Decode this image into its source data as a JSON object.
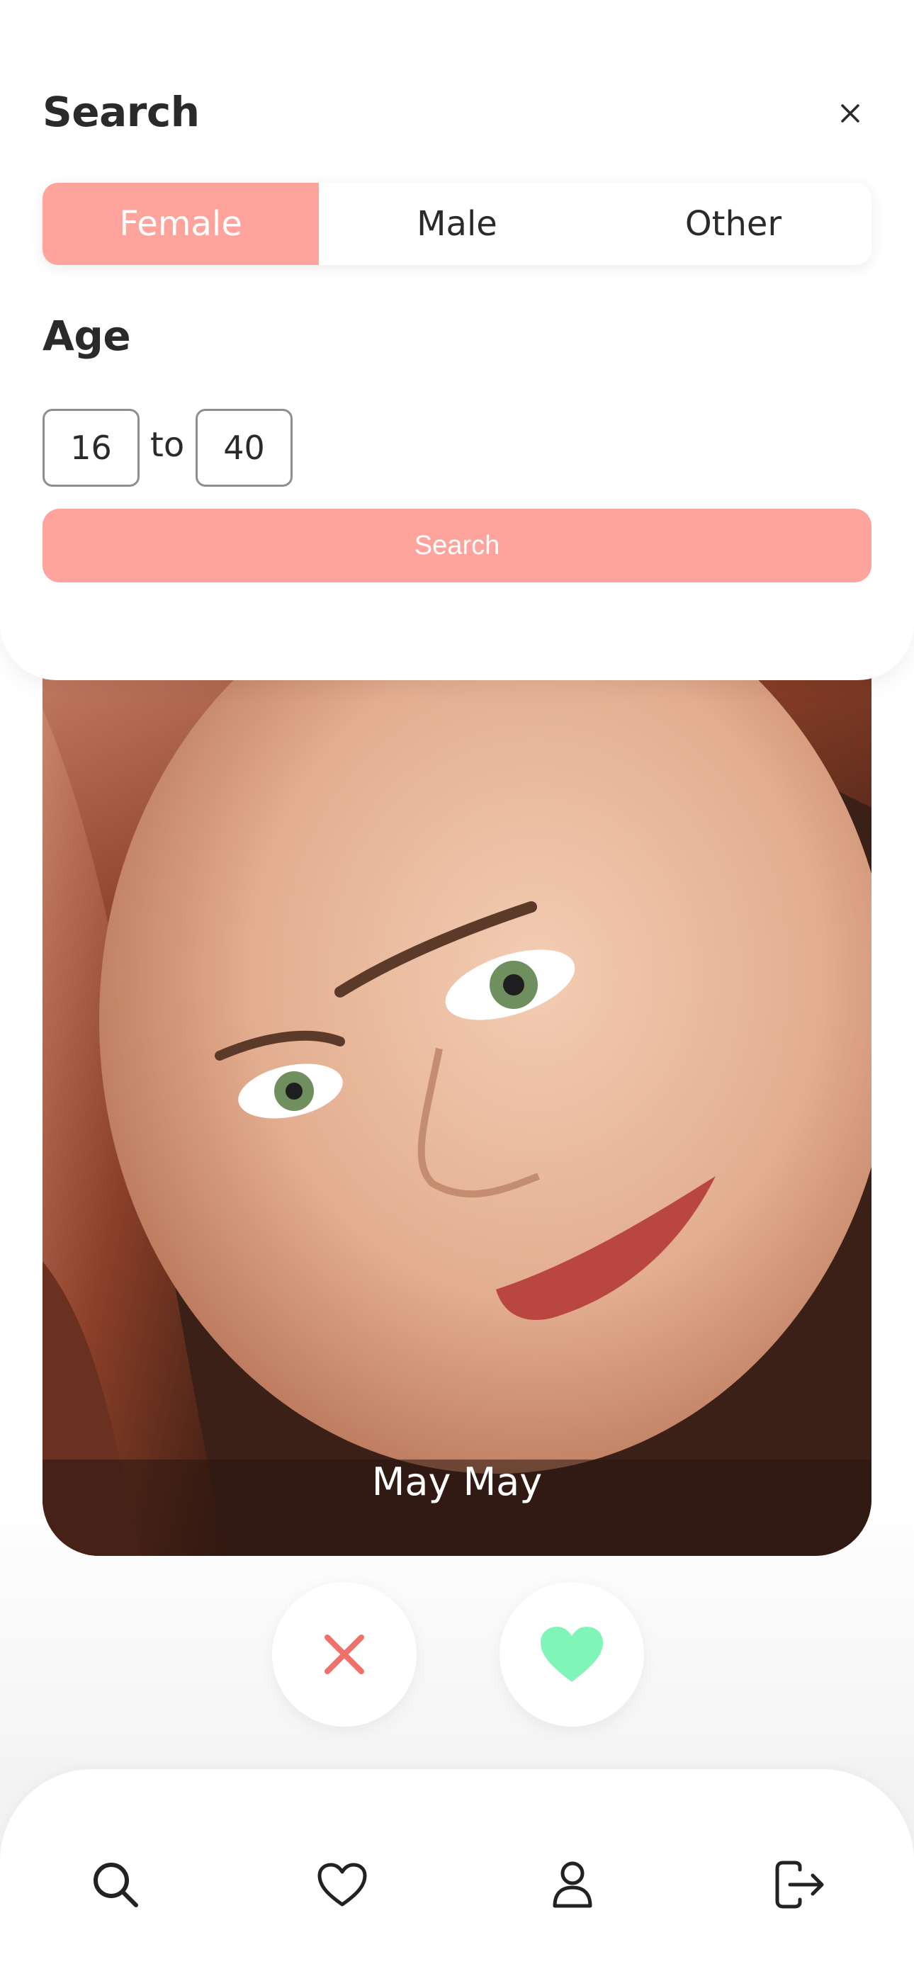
{
  "search_sheet": {
    "title": "Search",
    "close_icon": "close-icon",
    "gender_options": [
      "Female",
      "Male",
      "Other"
    ],
    "selected_gender": "Female",
    "age_label": "Age",
    "age_min": "16",
    "age_separator": "to",
    "age_max": "40",
    "search_button_label": "Search"
  },
  "profile_card": {
    "name": "May May"
  },
  "actions": {
    "dislike_icon": "close-icon",
    "like_icon": "heart-icon"
  },
  "bottom_nav": {
    "items": [
      "search-icon",
      "heart-icon",
      "profile-icon",
      "logout-icon"
    ]
  },
  "colors": {
    "accent": "#fea49c",
    "dislike": "#f2706a",
    "like": "#7ff5b8",
    "text": "#2a2a2a"
  }
}
